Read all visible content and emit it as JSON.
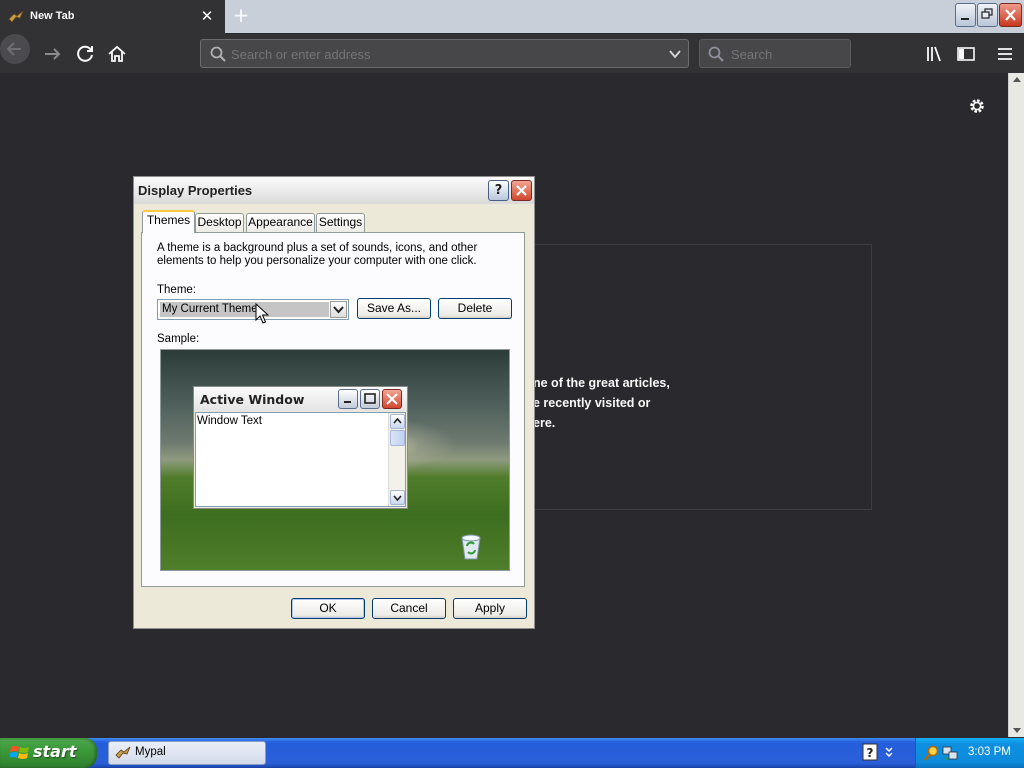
{
  "browser": {
    "tab_title": "New Tab",
    "tab_close": "✕",
    "new_tab": "+",
    "url_placeholder": "Search or enter address",
    "search_placeholder": "Search"
  },
  "page": {
    "snippet_lines": [
      "ne of the great articles,",
      "e recently visited or",
      "ere."
    ]
  },
  "dialog": {
    "title": "Display Properties",
    "help": "?",
    "tabs": [
      "Themes",
      "Desktop",
      "Appearance",
      "Settings"
    ],
    "active_tab": "Themes",
    "description": "A theme is a background plus a set of sounds, icons, and other elements to help you personalize your computer with one click.",
    "theme_label": "Theme:",
    "theme_value": "My Current Theme",
    "save_as": "Save As...",
    "delete": "Delete",
    "sample_label": "Sample:",
    "sample_window_title": "Active Window",
    "sample_window_text": "Window Text",
    "ok": "OK",
    "cancel": "Cancel",
    "apply": "Apply"
  },
  "taskbar": {
    "start": "start",
    "task_label": "Mypal",
    "clock": "3:03 PM"
  },
  "colors": {
    "browser_bg": "#2a2a2e",
    "toolbar": "#323234",
    "xp_taskbar": "#245edb",
    "xp_start": "#3c9a3a",
    "dialog_face": "#ece9d8"
  }
}
